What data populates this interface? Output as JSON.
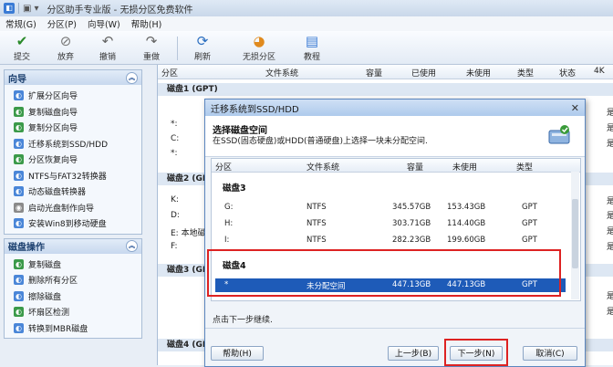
{
  "window": {
    "title": "分区助手专业版 - 无损分区免费软件"
  },
  "menu": [
    "常规(G)",
    "分区(P)",
    "向导(W)",
    "帮助(H)"
  ],
  "toolbar": {
    "commit": "提交",
    "discard": "放弃",
    "undo": "撤销",
    "redo": "重做",
    "refresh": "刷新",
    "lossless": "无损分区",
    "tutorial": "教程"
  },
  "sidebar": {
    "wizard_title": "向导",
    "wizard_items": [
      "扩展分区向导",
      "复制磁盘向导",
      "复制分区向导",
      "迁移系统到SSD/HDD",
      "分区恢复向导",
      "NTFS与FAT32转换器",
      "动态磁盘转换器",
      "启动光盘制作向导",
      "安装Win8到移动硬盘"
    ],
    "disk_ops_title": "磁盘操作",
    "disk_ops_items": [
      "复制磁盘",
      "删除所有分区",
      "擦除磁盘",
      "坏扇区检测",
      "转换到MBR磁盘"
    ]
  },
  "main": {
    "columns": [
      "分区",
      "文件系统",
      "容量",
      "已使用",
      "未使用",
      "类型",
      "状态",
      "4K"
    ],
    "disks": [
      {
        "name": "磁盘1 (GPT)",
        "parts": [
          "*:",
          "C:",
          "*:"
        ]
      },
      {
        "name": "磁盘2 (GPT)",
        "parts": [
          "K:",
          "D:",
          "E: 本地磁盘",
          "F:"
        ]
      },
      {
        "name": "磁盘3 (GPT)",
        "parts": [
          "G:",
          "H:",
          "I:"
        ]
      },
      {
        "name": "磁盘4 (GPT)",
        "parts": []
      }
    ],
    "right_marks": [
      "是",
      "是",
      "是",
      "是",
      "是",
      "是",
      "是",
      "是",
      "是"
    ]
  },
  "dialog": {
    "title": "迁移系统到SSD/HDD",
    "header_title": "选择磁盘空间",
    "header_sub": "在SSD(固态硬盘)或HDD(普通硬盘)上选择一块未分配空间.",
    "columns": [
      "分区",
      "文件系统",
      "容量",
      "未使用",
      "类型"
    ],
    "disk3_label": "磁盘3",
    "disk3_rows": [
      {
        "part": "G:",
        "fs": "NTFS",
        "cap": "345.57GB",
        "free": "153.43GB",
        "type": "GPT"
      },
      {
        "part": "H:",
        "fs": "NTFS",
        "cap": "303.71GB",
        "free": "114.40GB",
        "type": "GPT"
      },
      {
        "part": "I:",
        "fs": "NTFS",
        "cap": "282.23GB",
        "free": "199.60GB",
        "type": "GPT"
      }
    ],
    "disk4_label": "磁盘4",
    "disk4_row": {
      "part": "*",
      "fs": "未分配空间",
      "cap": "447.13GB",
      "free": "447.13GB",
      "type": "GPT"
    },
    "hint": "点击下一步继续.",
    "buttons": {
      "help": "帮助(H)",
      "back": "上一步(B)",
      "next": "下一步(N)",
      "cancel": "取消(C)"
    },
    "close_glyph": "✕"
  },
  "colors": {
    "selection": "#1e5bb8",
    "highlight_box": "#dd2222",
    "accent": "#3a7bd5"
  }
}
